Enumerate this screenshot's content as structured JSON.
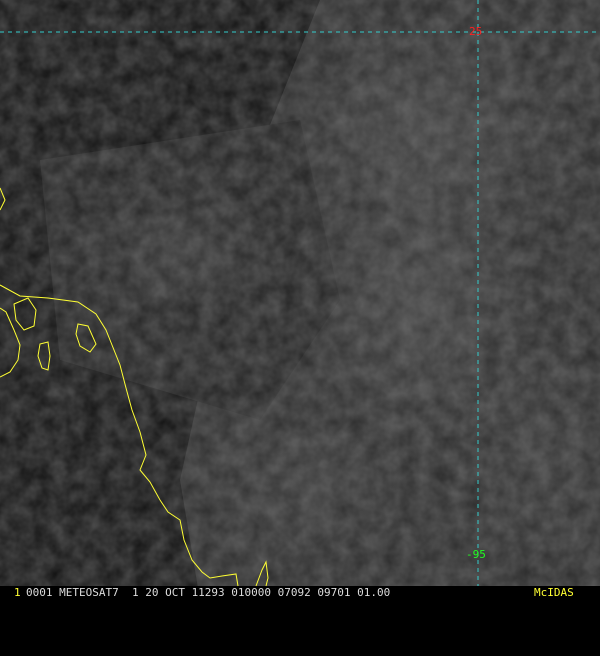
{
  "satellite_image": {
    "graticule": {
      "latitude_label": "25",
      "longitude_label": "-95",
      "latitude_color": "#ff2020",
      "longitude_color": "#20ff20",
      "line_color": "#33cccc"
    },
    "coastline_color": "#ffff33",
    "status_bar": {
      "frame_number": "1",
      "text": "0001 METEOSAT7  1 20 OCT 11293 010000 07092 09701 01.00",
      "brand": "McIDAS",
      "frame_number_color": "#ffff33",
      "text_color": "#dddddd",
      "brand_color": "#ffff33"
    }
  }
}
